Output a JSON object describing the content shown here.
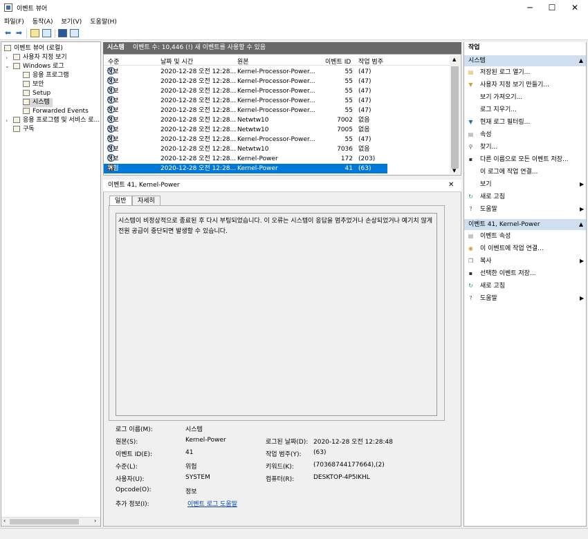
{
  "window": {
    "title": "이벤트 뷰어",
    "minimize": "─",
    "maximize": "☐",
    "close": "✕"
  },
  "menu": [
    "파일(F)",
    "동작(A)",
    "보기(V)",
    "도움말(H)"
  ],
  "tree": {
    "root": "이벤트 뷰어 (로컬)",
    "custom_views": "사용자 지정 보기",
    "windows_logs": "Windows 로그",
    "logs": [
      "응용 프로그램",
      "보안",
      "Setup",
      "시스템",
      "Forwarded Events"
    ],
    "app_service_logs": "응용 프로그램 및 서비스 로...",
    "subscriptions": "구독"
  },
  "center": {
    "header_name": "시스템",
    "header_count": "이벤트 수: 10,446 (!) 새 이벤트를 사용할 수 있음",
    "columns": [
      "수준",
      "날짜 및 시간",
      "원본",
      "이벤트 ID",
      "작업 범주"
    ],
    "rows": [
      {
        "level": "정보",
        "date": "2020-12-28 오전 12:28...",
        "source": "Kernel-Processor-Power...",
        "id": "55",
        "cat": "(47)",
        "icon": "info"
      },
      {
        "level": "정보",
        "date": "2020-12-28 오전 12:28...",
        "source": "Kernel-Processor-Power...",
        "id": "55",
        "cat": "(47)",
        "icon": "info"
      },
      {
        "level": "정보",
        "date": "2020-12-28 오전 12:28...",
        "source": "Kernel-Processor-Power...",
        "id": "55",
        "cat": "(47)",
        "icon": "info"
      },
      {
        "level": "정보",
        "date": "2020-12-28 오전 12:28...",
        "source": "Kernel-Processor-Power...",
        "id": "55",
        "cat": "(47)",
        "icon": "info"
      },
      {
        "level": "정보",
        "date": "2020-12-28 오전 12:28...",
        "source": "Kernel-Processor-Power...",
        "id": "55",
        "cat": "(47)",
        "icon": "info"
      },
      {
        "level": "정보",
        "date": "2020-12-28 오전 12:28...",
        "source": "Netwtw10",
        "id": "7002",
        "cat": "없음",
        "icon": "info"
      },
      {
        "level": "정보",
        "date": "2020-12-28 오전 12:28...",
        "source": "Netwtw10",
        "id": "7005",
        "cat": "없음",
        "icon": "info"
      },
      {
        "level": "정보",
        "date": "2020-12-28 오전 12:28...",
        "source": "Kernel-Processor-Power...",
        "id": "55",
        "cat": "(47)",
        "icon": "info"
      },
      {
        "level": "정보",
        "date": "2020-12-28 오전 12:28...",
        "source": "Netwtw10",
        "id": "7036",
        "cat": "없음",
        "icon": "info"
      },
      {
        "level": "정보",
        "date": "2020-12-28 오전 12:28...",
        "source": "Kernel-Power",
        "id": "172",
        "cat": "(203)",
        "icon": "info"
      },
      {
        "level": "위험",
        "date": "2020-12-28 오전 12:28...",
        "source": "Kernel-Power",
        "id": "41",
        "cat": "(63)",
        "icon": "critical",
        "selected": true
      }
    ]
  },
  "detail": {
    "title": "이벤트 41, Kernel-Power",
    "close": "✕",
    "tabs": [
      "일반",
      "자세히"
    ],
    "description": "시스템이 비정상적으로 종료된 후 다시 부팅되었습니다. 이 오류는 시스템이 응답을 멈추었거나 손상되었거나 예기치 않게 전원 공급이 중단되면 발생할 수 있습니다.",
    "labels": {
      "log_name": "로그 이름(M):",
      "source": "원본(S):",
      "event_id": "이벤트 ID(E):",
      "level": "수준(L):",
      "user": "사용자(U):",
      "opcode": "Opcode(O):",
      "more_info": "추가 정보(I):",
      "logged": "로그된 날짜(D):",
      "task_category": "작업 범주(Y):",
      "keywords": "키워드(K):",
      "computer": "컴퓨터(R):"
    },
    "values": {
      "log_name": "시스템",
      "source": "Kernel-Power",
      "event_id": "41",
      "level": "위험",
      "user": "SYSTEM",
      "opcode": "정보",
      "more_info": "이벤트 로그 도움말",
      "logged": "2020-12-28 오전 12:28:48",
      "task_category": "(63)",
      "keywords": "(70368744177664),(2)",
      "computer": "DESKTOP-4P5IKHL"
    }
  },
  "actions": {
    "title": "작업",
    "section1": "시스템",
    "items1": [
      "저장된 로그 열기...",
      "사용자 지정 보기 만들기...",
      "보기 가져오기...",
      "로그 지우기...",
      "현재 로그 필터링...",
      "속성",
      "찾기...",
      "다른 이름으로 모든 이벤트 저장...",
      "이 로그에 작업 연결...",
      "보기",
      "새로 고침",
      "도움말"
    ],
    "section2": "이벤트 41, Kernel-Power",
    "items2": [
      "이벤트 속성",
      "이 이벤트에 작업 연결...",
      "복사",
      "선택한 이벤트 저장...",
      "새로 고침",
      "도움말"
    ]
  }
}
